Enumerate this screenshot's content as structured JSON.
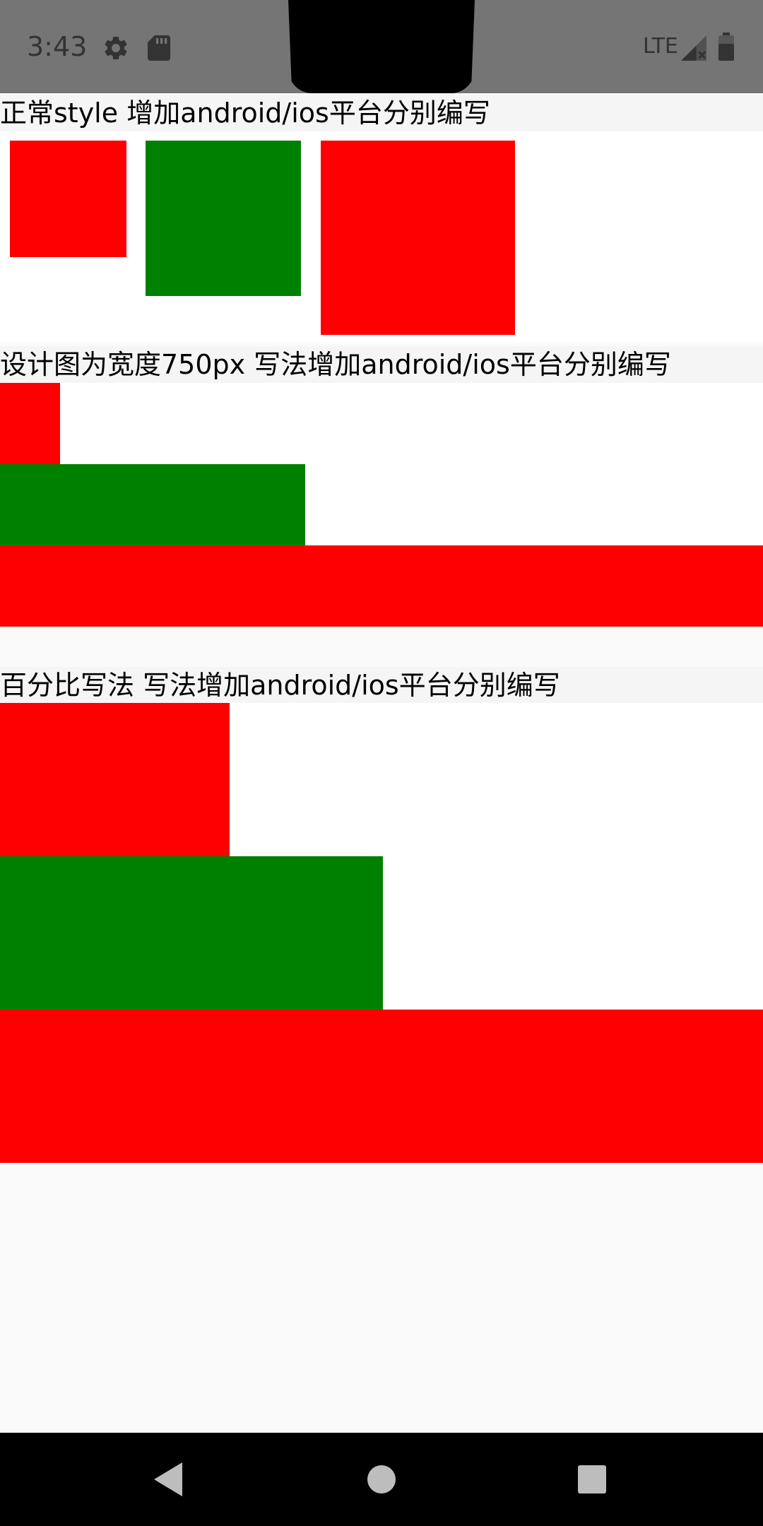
{
  "status_bar": {
    "time": "3:43",
    "network": "LTE",
    "icons": [
      "gear-icon",
      "sd-card-icon",
      "signal-icon",
      "battery-icon"
    ],
    "background": "#757575"
  },
  "sections": [
    {
      "title": "正常style 增加android/ios平台分别编写",
      "box_colors": [
        "#ff0000",
        "#008000",
        "#ff0000"
      ]
    },
    {
      "title": "设计图为宽度750px 写法增加android/ios平台分别编写",
      "box_colors": [
        "#ff0000",
        "#008000",
        "#ff0000"
      ]
    },
    {
      "title": "百分比写法 写法增加android/ios平台分别编写",
      "box_colors": [
        "#ff0000",
        "#008000",
        "#ff0000"
      ]
    }
  ],
  "nav_bar": {
    "icons": [
      "back-icon",
      "home-icon",
      "recents-icon"
    ],
    "background": "#000000"
  }
}
